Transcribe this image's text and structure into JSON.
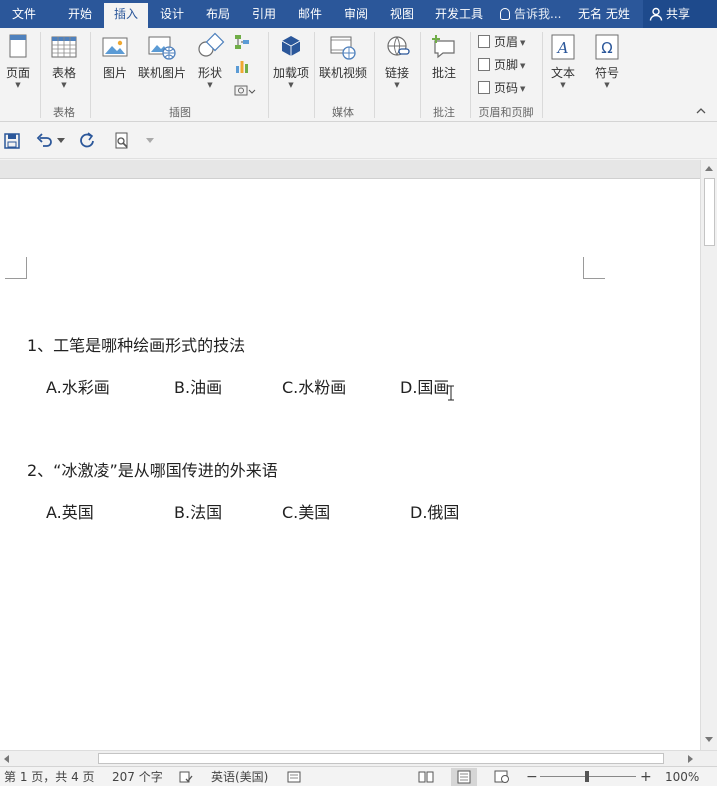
{
  "tabs": [
    {
      "label": "文件"
    },
    {
      "label": "开始"
    },
    {
      "label": "插入"
    },
    {
      "label": "设计"
    },
    {
      "label": "布局"
    },
    {
      "label": "引用"
    },
    {
      "label": "邮件"
    },
    {
      "label": "审阅"
    },
    {
      "label": "视图"
    },
    {
      "label": "开发工具"
    }
  ],
  "active_tab": "插入",
  "tell_me": "告诉我...",
  "user_name": "无名 无姓",
  "share_label": "共享",
  "ribbon": {
    "pages": "页面",
    "table": "表格",
    "picture": "图片",
    "online_picture": "联机图片",
    "shapes": "形状",
    "addins": "加载项",
    "online_video": "联机视频",
    "link": "链接",
    "comment": "批注",
    "header": "页眉",
    "footer": "页脚",
    "page_number": "页码",
    "text": "文本",
    "symbol": "符号",
    "groups": {
      "tables": "表格",
      "illustrations": "插图",
      "media": "媒体",
      "comments": "批注",
      "header_footer": "页眉和页脚"
    }
  },
  "document": {
    "q1": "1、工笔是哪种绘画形式的技法",
    "q1_options": [
      "A.水彩画",
      "B.油画",
      "C.水粉画",
      "D.国画"
    ],
    "q2": "2、“冰激凌”是从哪国传进的外来语",
    "q2_options": [
      "A.英国",
      "B.法国",
      "C.美国",
      "D.俄国"
    ]
  },
  "status": {
    "page": "第 1 页，共 4 页",
    "words": "207 个字",
    "language": "英语(美国)",
    "zoom": "100%"
  },
  "colors": {
    "accent": "#2b579a",
    "ribbon_bg": "#f3f3f3",
    "doc_bg": "#ffffff"
  }
}
